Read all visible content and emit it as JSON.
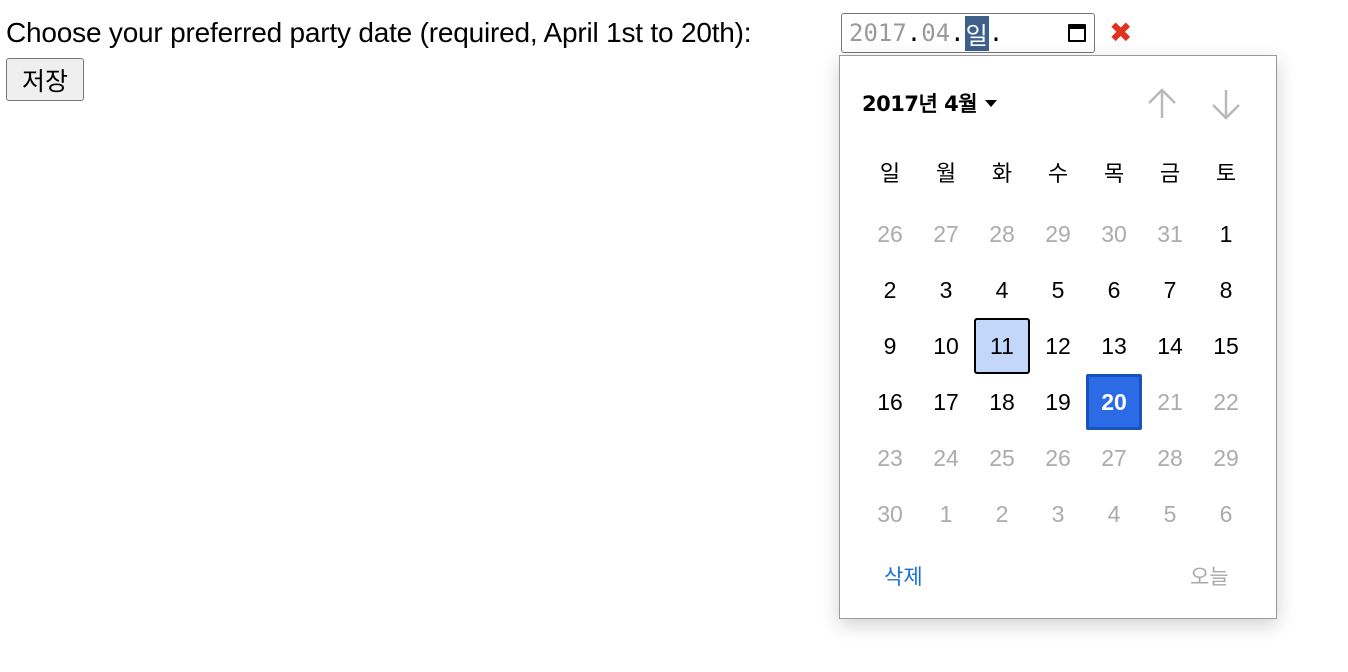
{
  "form": {
    "label": "Choose your preferred party date (required, April 1st to 20th):",
    "date_input": {
      "year": "2017",
      "sep1": ". ",
      "month": "04",
      "sep2": ". ",
      "day": "일",
      "sep3": "."
    },
    "invalid_icon": "✖",
    "submit_label": "저장"
  },
  "picker": {
    "month_title": "2017년 4월",
    "weekdays": [
      "일",
      "월",
      "화",
      "수",
      "목",
      "금",
      "토"
    ],
    "weeks": [
      [
        "26",
        "27",
        "28",
        "29",
        "30",
        "31",
        "1"
      ],
      [
        "2",
        "3",
        "4",
        "5",
        "6",
        "7",
        "8"
      ],
      [
        "9",
        "10",
        "11",
        "12",
        "13",
        "14",
        "15"
      ],
      [
        "16",
        "17",
        "18",
        "19",
        "20",
        "21",
        "22"
      ],
      [
        "23",
        "24",
        "25",
        "26",
        "27",
        "28",
        "29"
      ],
      [
        "30",
        "1",
        "2",
        "3",
        "4",
        "5",
        "6"
      ]
    ],
    "clear_label": "삭제",
    "today_label": "오늘"
  },
  "colors": {
    "selected_bg": "#2b6ce6",
    "today_bg": "#c3d7fb",
    "invalid": "#e0331f",
    "link": "#1a6fd6"
  },
  "icons": {
    "nav_up": "arrow-up-icon",
    "nav_down": "arrow-down-icon",
    "calendar": "calendar-icon",
    "invalid": "invalid-x-icon"
  }
}
